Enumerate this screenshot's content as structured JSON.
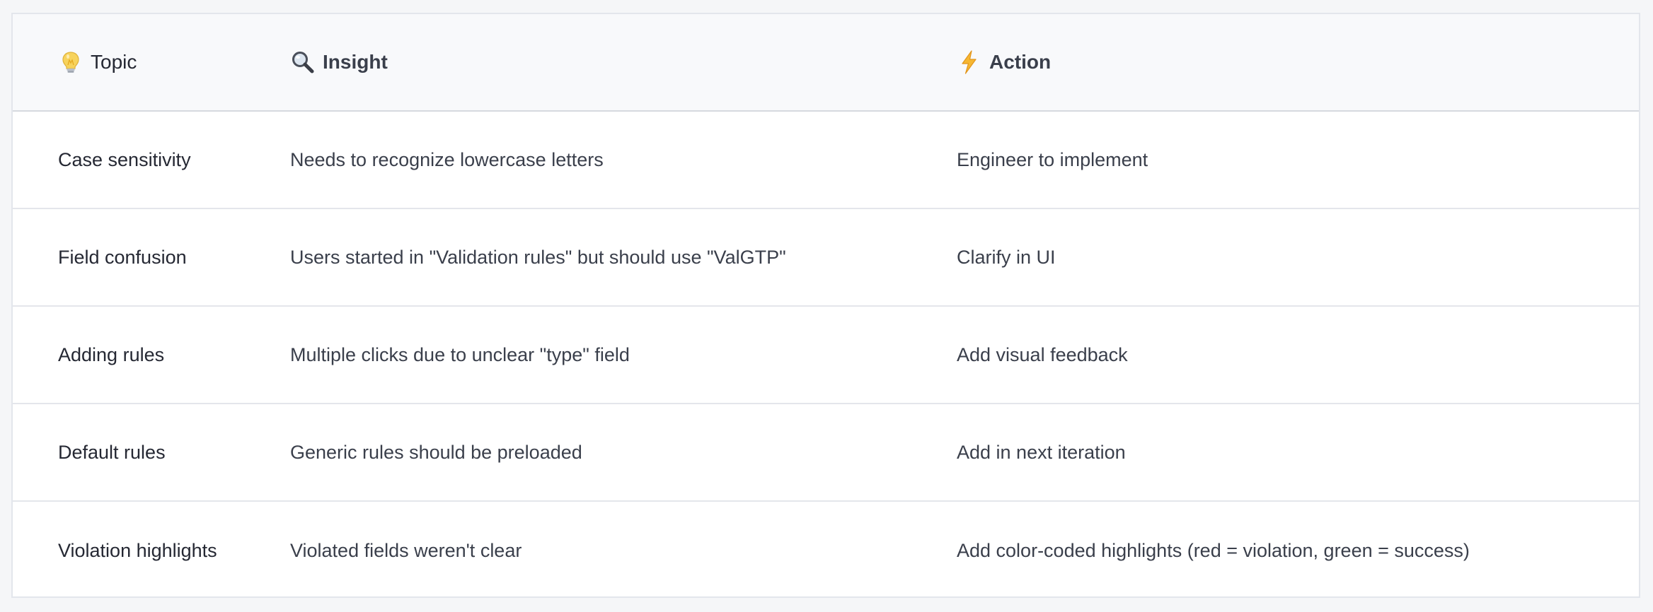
{
  "table": {
    "headers": {
      "topic": "Topic",
      "insight": "Insight",
      "action": "Action"
    },
    "header_icons": {
      "topic": "lightbulb-icon",
      "insight": "magnifying-glass-icon",
      "action": "lightning-bolt-icon"
    },
    "rows": [
      {
        "topic": "Case sensitivity",
        "insight": "Needs to recognize lowercase letters",
        "action": "Engineer to implement"
      },
      {
        "topic": "Field confusion",
        "insight": "Users started in \"Validation rules\" but should use \"ValGTP\"",
        "action": "Clarify in UI"
      },
      {
        "topic": "Adding rules",
        "insight": "Multiple clicks due to unclear \"type\" field",
        "action": "Add visual feedback"
      },
      {
        "topic": "Default rules",
        "insight": "Generic rules should be preloaded",
        "action": "Add in next iteration"
      },
      {
        "topic": "Violation highlights",
        "insight": "Violated fields weren't clear",
        "action": "Add color-coded highlights (red = violation, green = success)"
      }
    ]
  },
  "colors": {
    "background": "#f5f6f8",
    "card": "#ffffff",
    "header_bg": "#f8f9fb",
    "divider": "#e4e6eb",
    "bulb": "#f4c64a",
    "bolt": "#f5a623"
  }
}
